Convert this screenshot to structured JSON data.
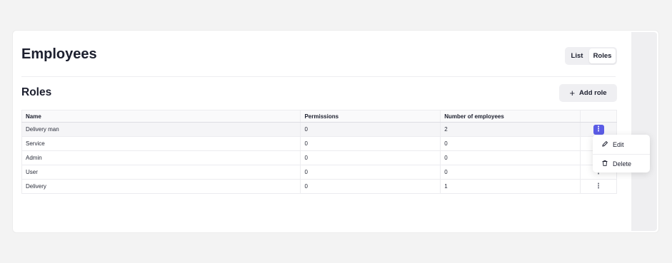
{
  "header": {
    "title": "Employees",
    "view_toggle": {
      "list_label": "List",
      "roles_label": "Roles",
      "selected": "Roles"
    }
  },
  "section": {
    "title": "Roles",
    "add_button_label": "Add role",
    "add_button_icon": "plus-icon"
  },
  "table": {
    "columns": [
      "Name",
      "Permissions",
      "Number of employees"
    ],
    "rows": [
      {
        "name": "Delivery man",
        "permissions": "0",
        "employees": "2"
      },
      {
        "name": "Service",
        "permissions": "0",
        "employees": "0"
      },
      {
        "name": "Admin",
        "permissions": "0",
        "employees": "0"
      },
      {
        "name": "User",
        "permissions": "0",
        "employees": "0"
      },
      {
        "name": "Delivery",
        "permissions": "0",
        "employees": "1"
      }
    ],
    "action_icon": "more-vertical-icon"
  },
  "row_menu": {
    "items": [
      {
        "label": "Edit",
        "icon": "pencil-icon"
      },
      {
        "label": "Delete",
        "icon": "trash-icon"
      }
    ]
  },
  "colors": {
    "accent": "#5b5ce6",
    "background": "#f3f3f3",
    "surface": "#ffffff"
  }
}
